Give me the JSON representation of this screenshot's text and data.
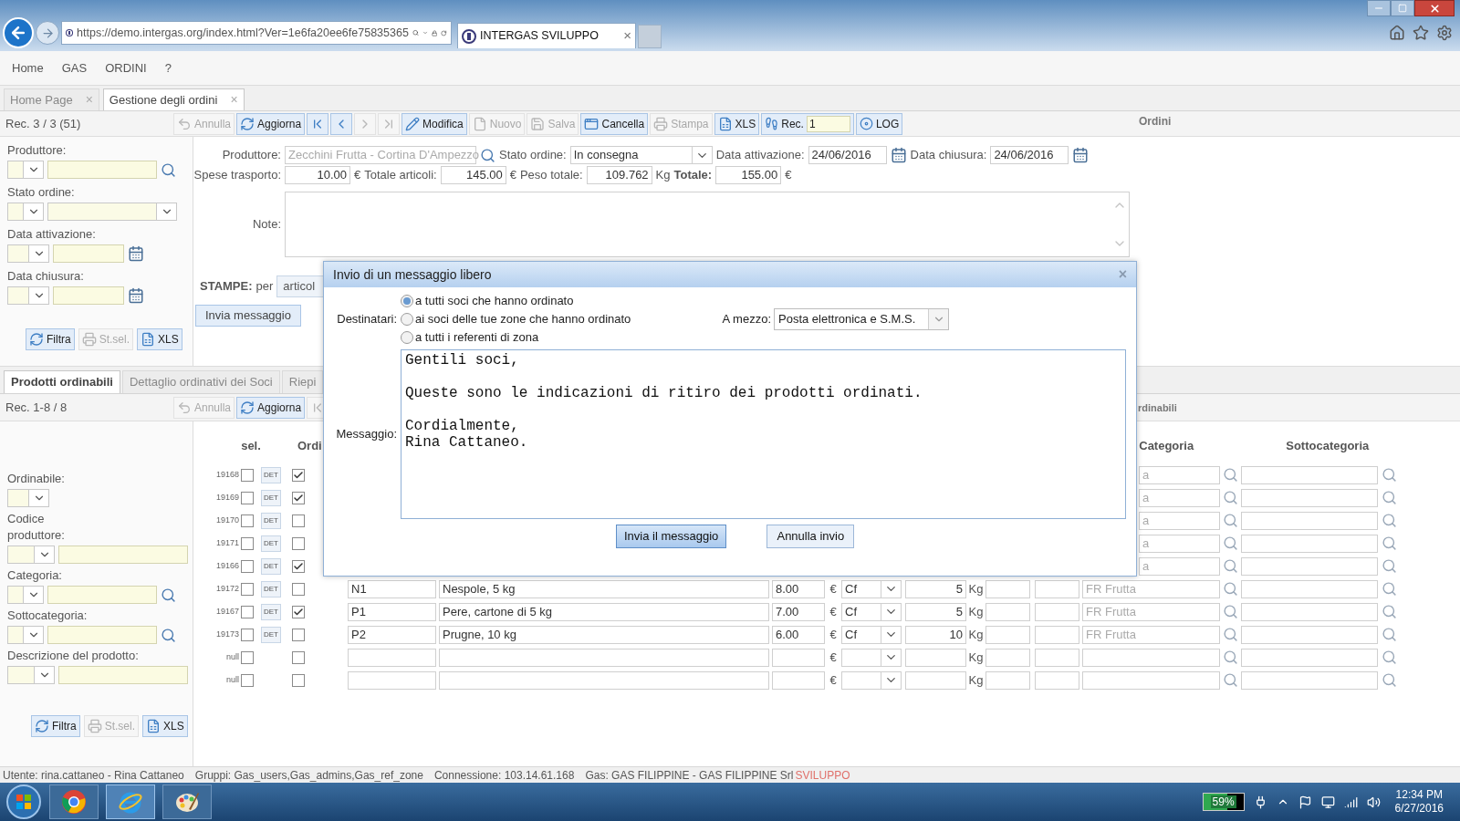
{
  "browser": {
    "url": "https://demo.intergas.org/index.html?Ver=1e6fa20ee6fe75835365",
    "tab_title": "INTERGAS SVILUPPO",
    "tab_close": "×"
  },
  "menu": [
    "Home",
    "GAS",
    "ORDINI",
    "?"
  ],
  "tabs": [
    {
      "label": "Home Page",
      "close": "×",
      "selected": false
    },
    {
      "label": "Gestione degli ordini",
      "close": "×",
      "selected": true
    }
  ],
  "toolbar": {
    "record": "Rec. 3 / 3 (51)",
    "buttons": [
      {
        "label": "Annulla",
        "disabled": true
      },
      {
        "label": "Aggiorna",
        "disabled": false
      },
      {
        "kind": "arrow",
        "disabled": false
      },
      {
        "kind": "arrow",
        "disabled": false
      },
      {
        "kind": "arrow",
        "disabled": true
      },
      {
        "kind": "arrow",
        "disabled": true
      },
      {
        "label": "Modifica",
        "disabled": false
      },
      {
        "label": "Nuovo",
        "disabled": true
      },
      {
        "label": "Salva",
        "disabled": true
      },
      {
        "label": "Cancella",
        "disabled": false
      },
      {
        "label": "Stampa",
        "disabled": true
      },
      {
        "label": "XLS",
        "disabled": false
      }
    ],
    "rec_label": "Rec.",
    "rec_value": "1",
    "log": "LOG",
    "section": "Ordini"
  },
  "filters": {
    "fields": [
      {
        "label": "Produttore:",
        "kind": "search"
      },
      {
        "label": "Stato ordine:",
        "kind": "select2"
      },
      {
        "label": "Data attivazione:",
        "kind": "date"
      },
      {
        "label": "Data chiusura:",
        "kind": "date"
      }
    ],
    "buttons": [
      {
        "label": "Filtra",
        "disabled": false
      },
      {
        "label": "St.sel.",
        "disabled": true
      },
      {
        "label": "XLS",
        "disabled": false
      }
    ]
  },
  "order": {
    "produttore_label": "Produttore:",
    "produttore": "Zecchini Frutta - Cortina D'Ampezzo",
    "stato_label": "Stato ordine:",
    "stato": "In consegna",
    "attivazione_label": "Data attivazione:",
    "attivazione": "24/06/2016",
    "chiusura_label": "Data chiusura:",
    "chiusura": "24/06/2016",
    "totals": [
      {
        "label": "Spese trasporto:",
        "value": "10.00",
        "unit": "€",
        "bold": false
      },
      {
        "label": "Totale articoli:",
        "value": "145.00",
        "unit": "€",
        "bold": false
      },
      {
        "label": "Peso totale:",
        "value": "109.762",
        "unit": "Kg",
        "bold": false
      },
      {
        "label": "Totale:",
        "value": "155.00",
        "unit": "€",
        "bold": true
      }
    ],
    "note_label": "Note:",
    "stampe_label": "STAMPE:",
    "stampe_per": "per",
    "stampe_button": "articol",
    "send_button": "Invia messaggio"
  },
  "dialog": {
    "title": "Invio di un messaggio libero",
    "close": "×",
    "recipients_label": "Destinatari:",
    "recipients": [
      {
        "label": "a tutti soci che hanno ordinato",
        "selected": true
      },
      {
        "label": "ai soci delle tue zone che hanno ordinato",
        "selected": false
      },
      {
        "label": "a tutti i referenti di zona",
        "selected": false
      }
    ],
    "via_label": "A mezzo:",
    "via": "Posta elettronica e S.M.S.",
    "message_label": "Messaggio:",
    "message": "Gentili soci,\n\nQueste sono le indicazioni di ritiro dei prodotti ordinati.\n\nCordialmente,\nRina Cattaneo.",
    "send": "Invia il messaggio",
    "cancel": "Annulla invio"
  },
  "lower_tabs": [
    {
      "label": "Prodotti ordinabili",
      "selected": true
    },
    {
      "label": "Dettaglio ordinativi dei Soci",
      "selected": false
    },
    {
      "label": "Riepi",
      "selected": false
    }
  ],
  "lower_toolbar": {
    "record": "Rec. 1-8 / 8",
    "buttons": [
      {
        "label": "Annulla",
        "disabled": true
      },
      {
        "label": "Aggiorna",
        "disabled": false
      },
      {
        "kind": "arrow",
        "disabled": true
      }
    ],
    "section": "rdinabili"
  },
  "product_filters": {
    "fields": [
      {
        "label": "Ordinabile:",
        "kind": "select"
      },
      {
        "label": "Codice produttore:",
        "kind": "text"
      },
      {
        "label": "Categoria:",
        "kind": "search"
      },
      {
        "label": "Sottocategoria:",
        "kind": "search"
      },
      {
        "label": "Descrizione del prodotto:",
        "kind": "text"
      }
    ],
    "buttons": [
      {
        "label": "Filtra",
        "disabled": false
      },
      {
        "label": "St.sel.",
        "disabled": true
      },
      {
        "label": "XLS",
        "disabled": false
      }
    ]
  },
  "products": {
    "columns": [
      "sel.",
      "Ordi",
      "Categoria",
      "Sottocategoria"
    ],
    "rows": [
      {
        "kind": "partial",
        "id": "19168",
        "selected": false,
        "orderable": true,
        "det": "DET",
        "category": "a"
      },
      {
        "kind": "partial",
        "id": "19169",
        "selected": false,
        "orderable": true,
        "det": "DET",
        "category": "a"
      },
      {
        "kind": "partial",
        "id": "19170",
        "selected": false,
        "orderable": false,
        "det": "DET",
        "category": "a"
      },
      {
        "kind": "partial",
        "id": "19171",
        "selected": false,
        "orderable": false,
        "det": "DET",
        "category": "a"
      },
      {
        "kind": "partial",
        "id": "19166",
        "selected": false,
        "orderable": true,
        "det": "DET",
        "category": "a"
      },
      {
        "kind": "full",
        "id": "19172",
        "selected": false,
        "orderable": false,
        "det": "DET",
        "code": "N1",
        "description": "Nespole, 5 kg",
        "price": "8.00",
        "currency": "€",
        "unit": "Cf",
        "qty": "5",
        "weight_unit": "Kg",
        "category": "FR Frutta"
      },
      {
        "kind": "full",
        "id": "19167",
        "selected": false,
        "orderable": true,
        "det": "DET",
        "code": "P1",
        "description": "Pere, cartone di 5 kg",
        "price": "7.00",
        "currency": "€",
        "unit": "Cf",
        "qty": "5",
        "weight_unit": "Kg",
        "category": "FR Frutta"
      },
      {
        "kind": "full",
        "id": "19173",
        "selected": false,
        "orderable": false,
        "det": "DET",
        "code": "P2",
        "description": "Prugne, 10 kg",
        "price": "6.00",
        "currency": "€",
        "unit": "Cf",
        "qty": "10",
        "weight_unit": "Kg",
        "category": "FR Frutta"
      },
      {
        "kind": "full",
        "id": "null",
        "selected": false,
        "orderable": false,
        "currency": "€",
        "weight_unit": "Kg"
      },
      {
        "kind": "full",
        "id": "null",
        "selected": false,
        "orderable": false,
        "currency": "€",
        "weight_unit": "Kg"
      }
    ]
  },
  "status_bar": [
    {
      "text": "Utente: rina.cattaneo - Rina Cattaneo",
      "color": "#555555"
    },
    {
      "text": "Gruppi: Gas_users,Gas_admins,Gas_ref_zone",
      "color": "#555555"
    },
    {
      "text": "Connessione: 103.14.61.168",
      "color": "#555555"
    },
    {
      "text": "Gas: GAS FILIPPINE - GAS FILIPPINE Srl",
      "color": "#555555"
    },
    {
      "text": "SVILUPPO",
      "color": "#e0706a"
    }
  ],
  "taskbar": {
    "battery": "59%",
    "time": "12:34 PM",
    "date": "6/27/2016"
  }
}
